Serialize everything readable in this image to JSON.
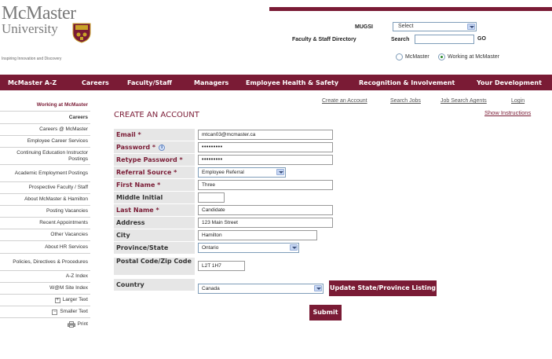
{
  "header": {
    "logo_line1": "McMaster",
    "logo_line2": "University",
    "tagline": "Inspiring Innovation and Discovery",
    "mugsi_label": "MUGSI",
    "mugsi_select_value": "Select",
    "directory_label": "Faculty & Staff Directory",
    "search_label": "Search",
    "search_value": "",
    "go_label": "GO",
    "radio_options": [
      {
        "label": "McMaster",
        "selected": false
      },
      {
        "label": "Working at McMaster",
        "selected": true
      }
    ]
  },
  "nav": [
    "McMaster A-Z",
    "Careers",
    "Faculty/Staff",
    "Managers",
    "Employee Health & Safety",
    "Recognition & Involvement",
    "Your Development"
  ],
  "sidebar": {
    "heading": "Working at McMaster",
    "items": [
      "Careers",
      "Careers @ McMaster",
      "Employee Career Services",
      "Continuing Education Instructor Postings",
      "Academic Employment Postings",
      "Prospective Faculty / Staff",
      "About McMaster & Hamilton",
      "Posting Vacancies",
      "Recent Appointments",
      "Other Vacancies",
      "About HR Services",
      "Policies, Directives & Procedures",
      "A-Z Index",
      "W@M Site Index",
      "Larger Text",
      "Smaller Text",
      "Print"
    ]
  },
  "toplinks": [
    "Create an Account",
    "Search Jobs",
    "Job Search Agents",
    "Login"
  ],
  "show_instructions": "Show Instructions",
  "page_title": "CREATE AN ACCOUNT",
  "form": {
    "email": {
      "label": "Email *",
      "value": "mtcan03@mcmaster.ca"
    },
    "password": {
      "label": "Password *",
      "value": "•••••••••"
    },
    "retype_password": {
      "label": "Retype Password *",
      "value": "•••••••••"
    },
    "referral_source": {
      "label": "Referral Source *",
      "value": "Employee Referral"
    },
    "first_name": {
      "label": "First Name *",
      "value": "Three"
    },
    "middle_initial": {
      "label": "Middle Initial",
      "value": ""
    },
    "last_name": {
      "label": "Last Name *",
      "value": "Candidate"
    },
    "address": {
      "label": "Address",
      "value": "123 Main Street"
    },
    "city": {
      "label": "City",
      "value": "Hamilton"
    },
    "province": {
      "label": "Province/State",
      "value": "Ontario"
    },
    "postal": {
      "label": "Postal Code/Zip Code",
      "value": "L2T 1H7"
    },
    "country": {
      "label": "Country",
      "value": "Canada"
    },
    "update_button": "Update State/Province Listing",
    "submit_button": "Submit"
  },
  "colors": {
    "brand": "#7a1b35",
    "label_bg": "#e6e6e6"
  }
}
